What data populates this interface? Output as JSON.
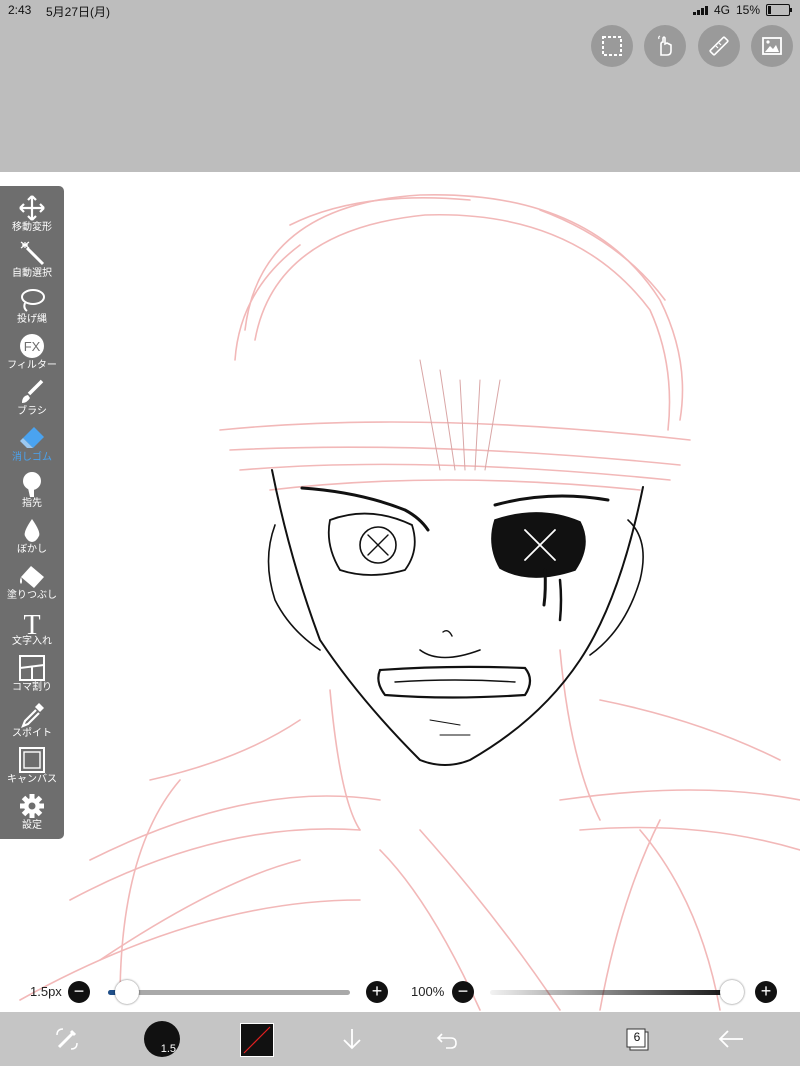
{
  "status": {
    "time": "2:43",
    "date": "5月27日(月)",
    "network": "4G",
    "battery": "15%",
    "battery_level": 0.15
  },
  "top_buttons": [
    {
      "name": "selection-icon"
    },
    {
      "name": "hand-gesture-icon"
    },
    {
      "name": "ruler-icon"
    },
    {
      "name": "image-icon"
    }
  ],
  "tools": [
    {
      "id": "move",
      "label": "移動変形",
      "icon": "move-icon"
    },
    {
      "id": "auto-select",
      "label": "自動選択",
      "icon": "magic-wand-icon"
    },
    {
      "id": "lasso",
      "label": "投げ縄",
      "icon": "lasso-icon"
    },
    {
      "id": "filter",
      "label": "フィルター",
      "icon": "fx-icon",
      "icon_text": "FX"
    },
    {
      "id": "brush",
      "label": "ブラシ",
      "icon": "brush-icon"
    },
    {
      "id": "eraser",
      "label": "消しゴム",
      "icon": "eraser-icon",
      "active": true
    },
    {
      "id": "finger",
      "label": "指先",
      "icon": "finger-icon"
    },
    {
      "id": "blur",
      "label": "ぼかし",
      "icon": "drop-icon"
    },
    {
      "id": "fill",
      "label": "塗りつぶし",
      "icon": "bucket-icon"
    },
    {
      "id": "text",
      "label": "文字入れ",
      "icon": "text-icon",
      "icon_text": "T"
    },
    {
      "id": "frame",
      "label": "コマ割り",
      "icon": "frame-divider-icon"
    },
    {
      "id": "eyedropper",
      "label": "スポイト",
      "icon": "eyedropper-icon"
    },
    {
      "id": "canvas",
      "label": "キャンバス",
      "icon": "canvas-icon"
    },
    {
      "id": "settings",
      "label": "設定",
      "icon": "gear-icon"
    }
  ],
  "brush_size": {
    "value_text": "1.5px",
    "minus": "−",
    "plus": "+",
    "level": 0.02
  },
  "opacity": {
    "value_text": "100%",
    "minus": "−",
    "plus": "+",
    "level": 1.0
  },
  "bottom_bar": {
    "brush_preview_size": "1.5",
    "layer_count": "6"
  },
  "colors": {
    "active_tool": "#4aa3f0",
    "sketch": "#f2b8b8",
    "ink": "#111111"
  }
}
